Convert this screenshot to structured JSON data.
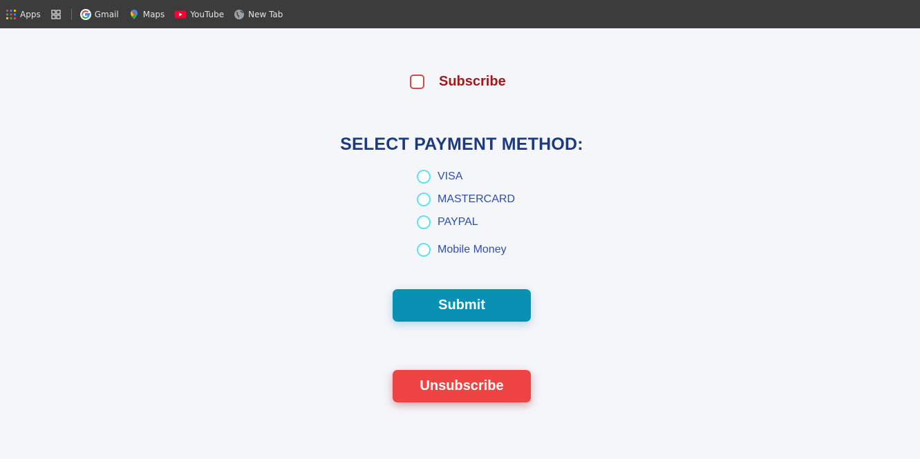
{
  "bookmarks": {
    "apps_label": "Apps",
    "gmail_label": "Gmail",
    "maps_label": "Maps",
    "youtube_label": "YouTube",
    "newtab_label": "New Tab"
  },
  "subscribe": {
    "label": "Subscribe",
    "checked": false
  },
  "payment": {
    "title": "SELECT PAYMENT METHOD:",
    "options": [
      {
        "label": "VISA"
      },
      {
        "label": "MASTERCARD"
      },
      {
        "label": "PAYPAL"
      },
      {
        "label": "Mobile Money"
      }
    ]
  },
  "actions": {
    "submit_label": "Submit",
    "unsubscribe_label": "Unsubscribe"
  },
  "colors": {
    "subscribe_text": "#a3181b",
    "title_text": "#1d3a80",
    "radio_border": "#5ee3ee",
    "submit_bg": "#0891b2",
    "unsubscribe_bg": "#ef4444"
  }
}
